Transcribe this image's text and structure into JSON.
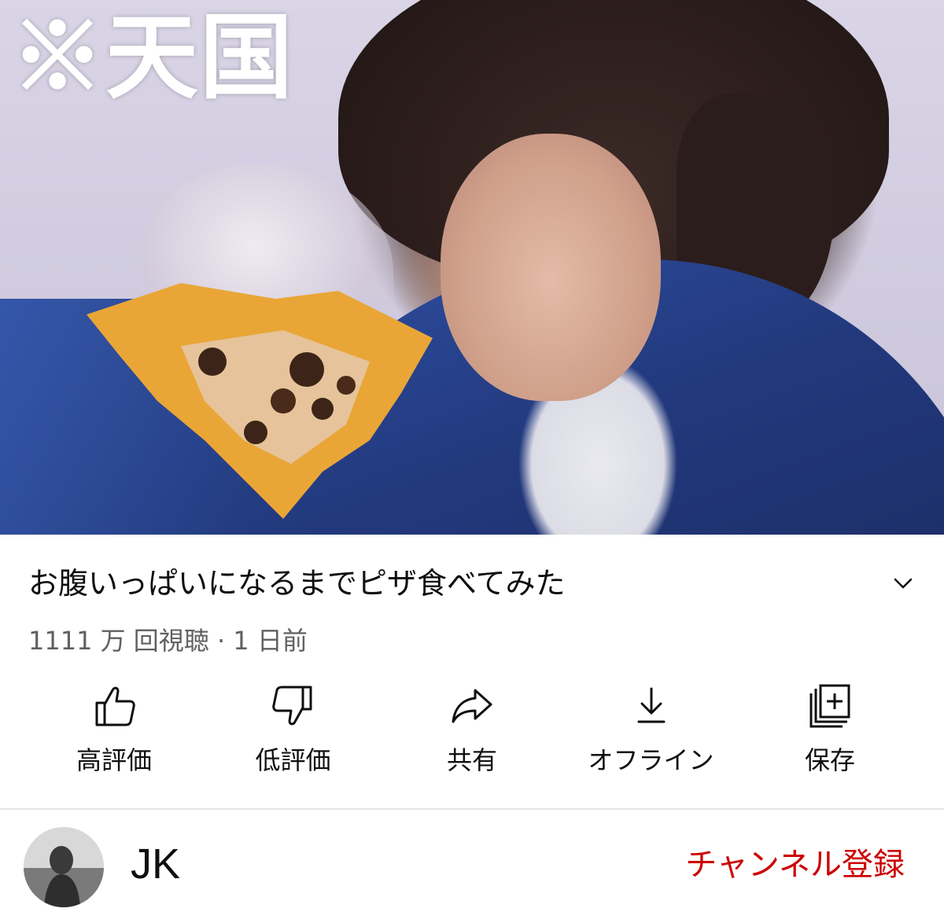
{
  "thumbnail": {
    "overlay_text": "※天国"
  },
  "video": {
    "title": "お腹いっぱいになるまでピザ食べてみた",
    "meta": "1111 万 回視聴 · 1 日前"
  },
  "actions": [
    {
      "label": "高評価",
      "icon": "thumbs-up-icon"
    },
    {
      "label": "低評価",
      "icon": "thumbs-down-icon"
    },
    {
      "label": "共有",
      "icon": "share-icon"
    },
    {
      "label": "オフライン",
      "icon": "download-icon"
    },
    {
      "label": "保存",
      "icon": "add-to-playlist-icon"
    }
  ],
  "channel": {
    "name": "JK",
    "subscribe_label": "チャンネル登録"
  },
  "colors": {
    "subscribe": "#cc0000",
    "meta_text": "#606060",
    "divider": "#e5e5e5"
  }
}
